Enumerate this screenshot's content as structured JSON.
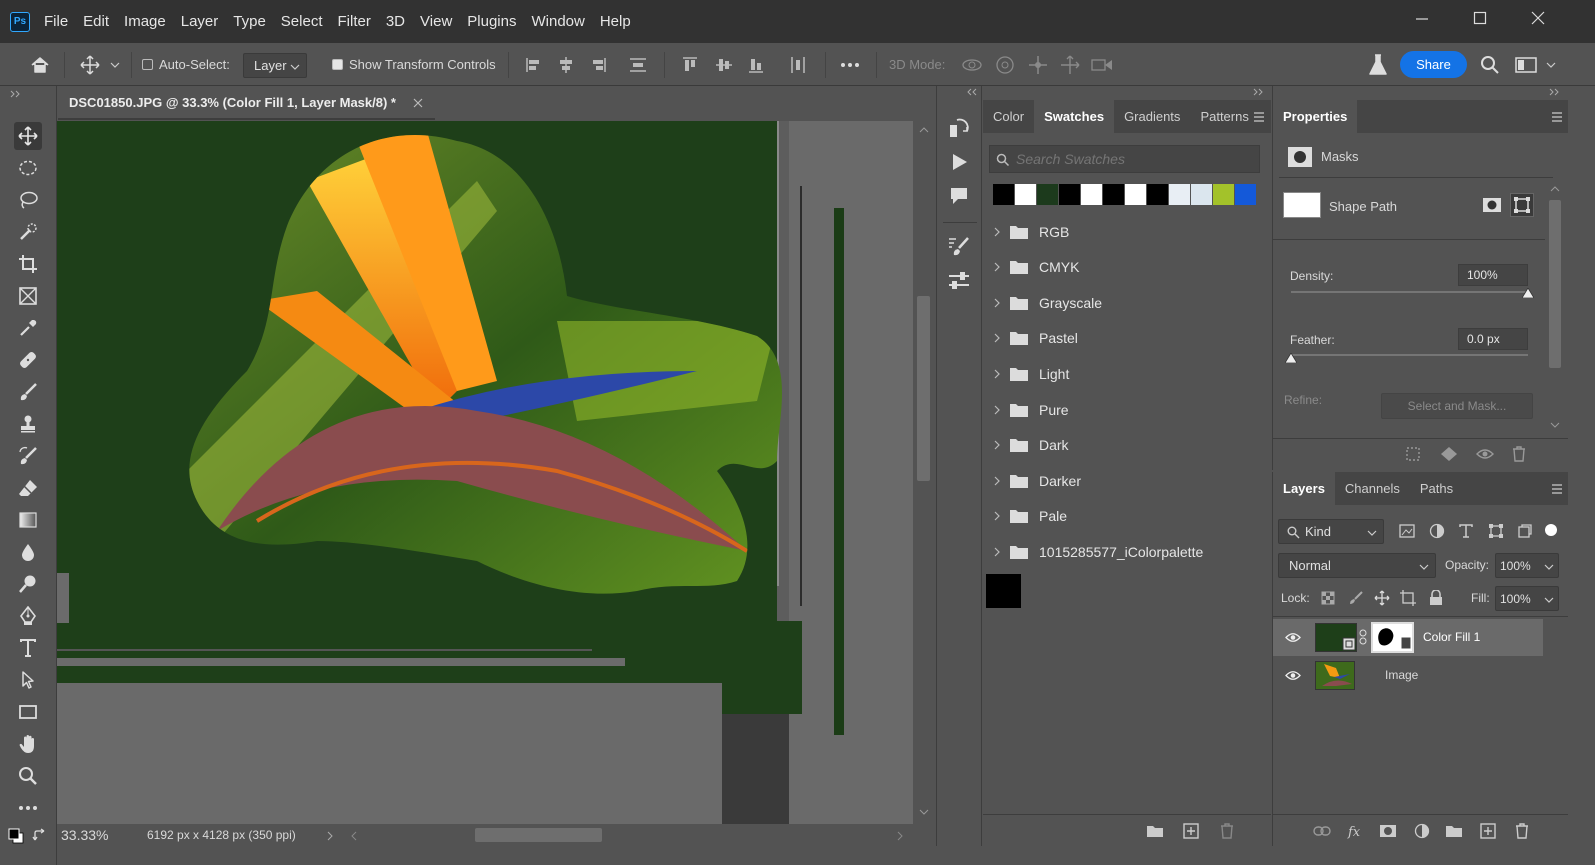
{
  "app": {
    "logo": "Ps"
  },
  "menu": [
    "File",
    "Edit",
    "Image",
    "Layer",
    "Type",
    "Select",
    "Filter",
    "3D",
    "View",
    "Plugins",
    "Window",
    "Help"
  ],
  "options": {
    "auto_select_label": "Auto-Select:",
    "auto_select_checked": false,
    "auto_select_target": "Layer",
    "show_transform_label": "Show Transform Controls",
    "show_transform_checked": true,
    "mode_3d_label": "3D Mode:",
    "share_label": "Share"
  },
  "document": {
    "tab_title": "DSC01850.JPG @ 33.3% (Color Fill 1, Layer Mask/8) *",
    "zoom": "33.33%",
    "info": "6192 px x 4128 px (350 ppi)"
  },
  "swatches_panel": {
    "tabs": [
      "Color",
      "Swatches",
      "Gradients",
      "Patterns"
    ],
    "active_tab": "Swatches",
    "search_placeholder": "Search Swatches",
    "recent_colors": [
      "#000000",
      "#ffffff",
      "#1c3a1c",
      "#000000",
      "#ffffff",
      "#000000",
      "#ffffff",
      "#000000",
      "#e8eef4",
      "#dbe6ee",
      "#a3c22a",
      "#1459d9"
    ],
    "groups": [
      "RGB",
      "CMYK",
      "Grayscale",
      "Pastel",
      "Light",
      "Pure",
      "Dark",
      "Darker",
      "Pale",
      "1015285577_iColorpalette"
    ],
    "foreground_swatch": "#000000"
  },
  "properties_panel": {
    "title": "Properties",
    "section": "Masks",
    "shape_path_label": "Shape Path",
    "density_label": "Density:",
    "density_value": "100%",
    "density_level": 1.0,
    "feather_label": "Feather:",
    "feather_value": "0.0 px",
    "feather_level": 0.0,
    "refine_label": "Refine:",
    "select_and_mask_label": "Select and Mask..."
  },
  "layers_panel": {
    "tabs": [
      "Layers",
      "Channels",
      "Paths"
    ],
    "active_tab": "Layers",
    "filter_kind": "Kind",
    "blend_mode": "Normal",
    "opacity_label": "Opacity:",
    "opacity_value": "100%",
    "lock_label": "Lock:",
    "fill_label": "Fill:",
    "fill_value": "100%",
    "layers": [
      {
        "name": "Color Fill 1",
        "visible": true,
        "selected": true
      },
      {
        "name": "Image",
        "visible": true,
        "selected": false
      }
    ]
  },
  "colors": {
    "accent": "#1473e6",
    "fill_green": "#1e3f19"
  }
}
